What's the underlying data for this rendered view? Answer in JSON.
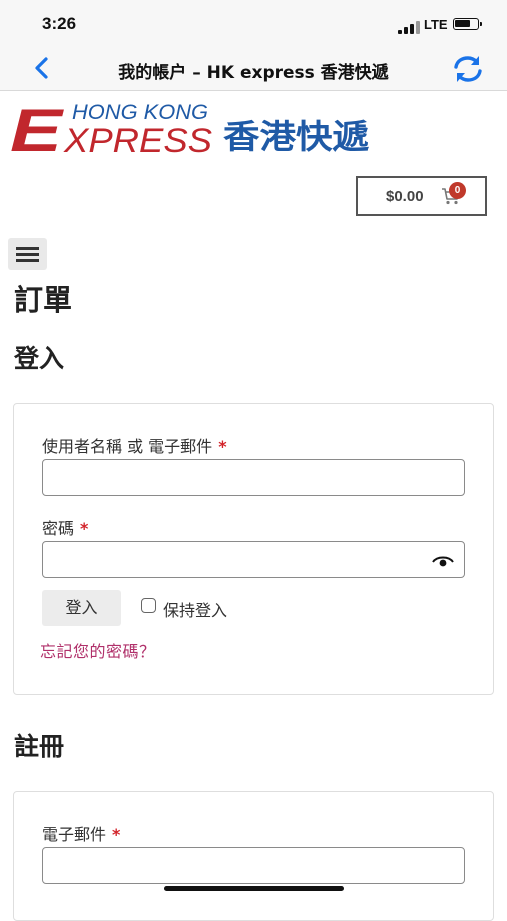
{
  "status_bar": {
    "time": "3:26",
    "network": "LTE"
  },
  "nav": {
    "title": "我的帳户 – HK express 香港快遞"
  },
  "logo": {
    "text_en": "HONG KONG",
    "text_express_initial": "E",
    "text_express_rest": "XPRESS",
    "text_zh": "香港快遞"
  },
  "cart": {
    "price": "$0.00",
    "count": "0"
  },
  "page": {
    "title": "訂單"
  },
  "login": {
    "heading": "登入",
    "username_label": "使用者名稱 或 電子郵件",
    "password_label": "密碼",
    "required_mark": "*",
    "username_value": "",
    "password_value": "",
    "button_label": "登入",
    "remember_label": "保持登入",
    "forgot_link": "忘記您的密碼？"
  },
  "register": {
    "heading": "註冊",
    "email_label": "電子郵件",
    "required_mark": "*",
    "email_value": ""
  },
  "colors": {
    "logo_red": "#c1272d",
    "logo_blue": "#1f5aa6",
    "link": "#b0306a",
    "nav_blue": "#1a73e8"
  }
}
